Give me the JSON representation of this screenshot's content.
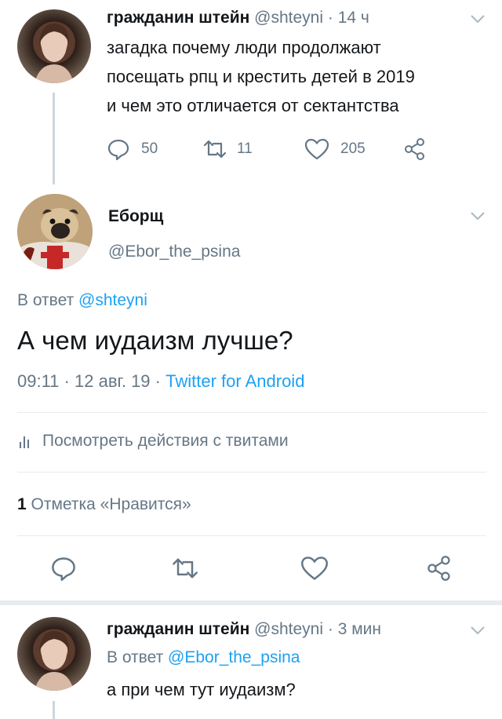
{
  "tweet1": {
    "display_name": "гражданин штейн",
    "handle": "@shteyni",
    "sep": "·",
    "time": "14 ч",
    "text_lines": [
      "загадка почему люди продолжают",
      "посещать рпц и крестить детей в 2019",
      "и чем это отличается от сектантства"
    ],
    "replies": "50",
    "retweets": "11",
    "likes": "205"
  },
  "main_tweet": {
    "display_name": "Еборщ",
    "handle": "@Ebor_the_psina",
    "reply_prefix": "В ответ",
    "reply_to": "@shteyni",
    "text": "А чем иудаизм лучше?",
    "time": "09:11",
    "sep1": "·",
    "date": "12 авг. 19",
    "sep2": "·",
    "source": "Twitter for Android",
    "activity_label": "Посмотреть действия с твитами",
    "likes_count": "1",
    "likes_label": "Отметка «Нравится»"
  },
  "tweet3": {
    "display_name": "гражданин штейн",
    "handle": "@shteyni",
    "sep": "·",
    "time": "3 мин",
    "reply_prefix": "В ответ",
    "reply_to": "@Ebor_the_psina",
    "text": "а при чем тут иудаизм?"
  },
  "colors": {
    "accent": "#1da1f2",
    "text": "#14171a",
    "muted": "#657786",
    "divider": "#e6ecf0"
  },
  "icons": {
    "reply": "reply-icon",
    "retweet": "retweet-icon",
    "like": "heart-icon",
    "share": "share-icon",
    "more": "chevron-down-icon",
    "activity": "bar-chart-icon"
  }
}
